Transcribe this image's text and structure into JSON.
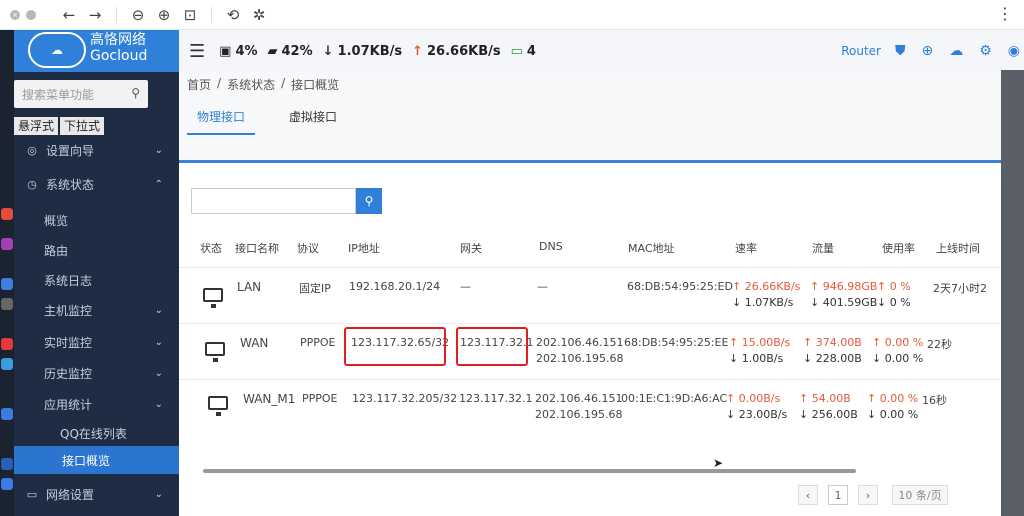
{
  "viewer": {
    "icons": [
      "back-arrow-icon",
      "forward-arrow-icon",
      "zoom-out-icon",
      "zoom-in-icon",
      "fit-icon",
      "rotate-icon",
      "magic-wand-icon"
    ],
    "glyphs": {
      "back": "←",
      "forward": "→",
      "zoom_out": "⊖",
      "zoom_in": "⊕",
      "fit": "⊡",
      "rotate": "⟲",
      "wand": "✲",
      "more": "⋮",
      "close": "×"
    }
  },
  "router": {
    "logo": {
      "cn": "高恪网络",
      "en": "Gocloud"
    },
    "search_placeholder": "搜索菜单功能",
    "modes": [
      "悬浮式",
      "下拉式"
    ],
    "nav": [
      {
        "label": "设置向导",
        "icon": "◎",
        "arrow": "⌄"
      },
      {
        "label": "系统状态",
        "icon": "◷",
        "arrow": "⌃"
      },
      {
        "label": "概览"
      },
      {
        "label": "路由"
      },
      {
        "label": "系统日志"
      },
      {
        "label": "主机监控",
        "arrow": "⌄"
      },
      {
        "label": "实时监控",
        "arrow": "⌄"
      },
      {
        "label": "历史监控",
        "arrow": "⌄"
      },
      {
        "label": "应用统计",
        "arrow": "⌄"
      },
      {
        "label": "QQ在线列表"
      },
      {
        "label": "接口概览"
      },
      {
        "label": "网络设置",
        "icon": "▭",
        "arrow": "⌄"
      }
    ],
    "topbar": {
      "cpu": "4%",
      "mem": "42%",
      "down": "1.07KB/s",
      "up": "26.66KB/s",
      "devices": "4",
      "router_label": "Router"
    },
    "breadcrumb": [
      "首页",
      "/",
      "系统状态",
      "/",
      "接口概览"
    ],
    "tabs": [
      "物理接口",
      "虚拟接口"
    ],
    "table": {
      "headers": [
        "状态",
        "接口名称",
        "协议",
        "IP地址",
        "网关",
        "DNS",
        "MAC地址",
        "速率",
        "流量",
        "使用率",
        "上线时间"
      ],
      "rows": [
        {
          "name": "LAN",
          "proto": "固定IP",
          "ip": "192.168.20.1/24",
          "gw": "—",
          "dns1": "—",
          "dns2": "",
          "mac": "68:DB:54:95:25:ED",
          "rate_up": "↑ 26.66KB/s",
          "rate_down": "↓ 1.07KB/s",
          "flow_up": "↑ 946.98GB",
          "flow_down": "↓ 401.59GB",
          "use_up": "↑ 0 %",
          "use_down": "↓ 0 %",
          "online": "2天7小时2"
        },
        {
          "name": "WAN",
          "proto": "PPPOE",
          "ip": "123.117.32.65/32",
          "gw": "123.117.32.1",
          "dns1": "202.106.46.151",
          "dns2": "202.106.195.68",
          "mac": "68:DB:54:95:25:EE",
          "rate_up": "↑ 15.00B/s",
          "rate_down": "↓ 1.00B/s",
          "flow_up": "↑ 374.00B",
          "flow_down": "↓ 228.00B",
          "use_up": "↑ 0.00 %",
          "use_down": "↓ 0.00 %",
          "online": "22秒"
        },
        {
          "name": "WAN_M1",
          "proto": "PPPOE",
          "ip": "123.117.32.205/32",
          "gw": "123.117.32.1",
          "dns1": "202.106.46.151",
          "dns2": "202.106.195.68",
          "mac": "00:1E:C1:9D:A6:AC",
          "rate_up": "↑ 0.00B/s",
          "rate_down": "↓ 23.00B/s",
          "flow_up": "↑ 54.00B",
          "flow_down": "↓ 256.00B",
          "use_up": "↑ 0.00 %",
          "use_down": "↓ 0.00 %",
          "online": "16秒"
        }
      ]
    },
    "pager": {
      "prev": "‹",
      "current": "1",
      "next": "›",
      "size": "10 条/页"
    }
  },
  "colors": {
    "accent": "#2e80d9",
    "sidebar": "#1f2d44",
    "highlight": "#e02020",
    "up": "#e55a3a"
  }
}
